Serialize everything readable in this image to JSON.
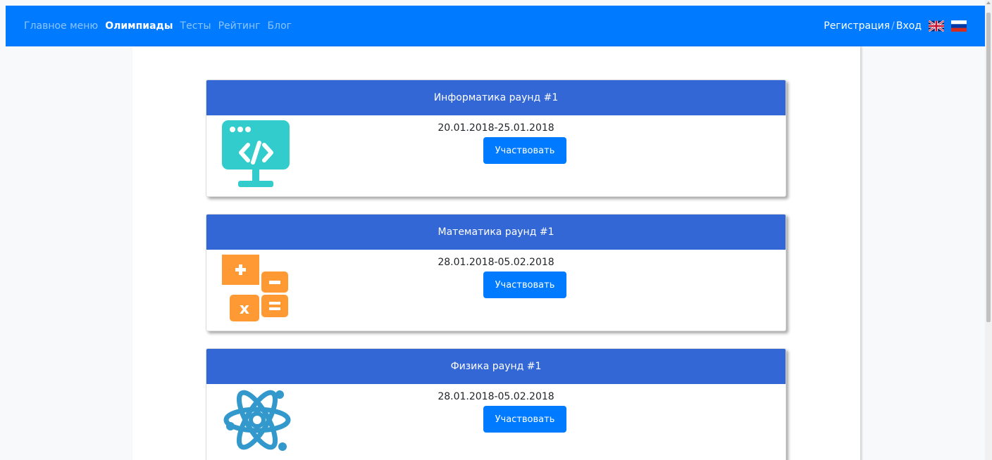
{
  "nav": {
    "links": [
      {
        "label": "Главное меню",
        "active": false
      },
      {
        "label": "Олимпиады",
        "active": true
      },
      {
        "label": "Тесты",
        "active": false
      },
      {
        "label": "Рейтинг",
        "active": false
      },
      {
        "label": "Блог",
        "active": false
      }
    ],
    "register": "Регистрация",
    "separator": "/",
    "login": "Вход",
    "flags": [
      "uk-flag-icon",
      "russia-flag-icon"
    ]
  },
  "olympiads": [
    {
      "title": "Информатика раунд #1",
      "dates": "20.01.2018-25.01.2018",
      "button": "Участвовать",
      "icon": "computer-code-icon",
      "icon_color": "#33cccc"
    },
    {
      "title": "Математика раунд #1",
      "dates": "28.01.2018-05.02.2018",
      "button": "Участвовать",
      "icon": "calculator-icon",
      "icon_color": "#ff9933"
    },
    {
      "title": "Физика раунд #1",
      "dates": "28.01.2018-05.02.2018",
      "button": "Участвовать",
      "icon": "atom-icon",
      "icon_color": "#3399cc"
    }
  ],
  "colors": {
    "navbar": "#007bff",
    "card_header": "#3467d6",
    "button": "#007bff",
    "page_bg": "#f8f9fa"
  }
}
